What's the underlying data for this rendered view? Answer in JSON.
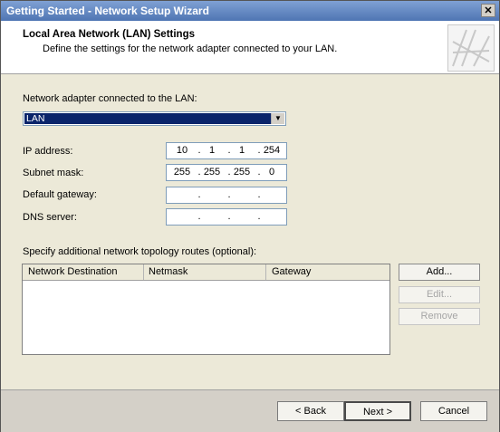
{
  "window": {
    "title": "Getting Started - Network Setup Wizard",
    "close_glyph": "✕"
  },
  "header": {
    "title": "Local Area Network (LAN) Settings",
    "subtitle": "Define the settings for the network adapter connected to your LAN."
  },
  "adapter": {
    "label": "Network adapter connected to the LAN:",
    "selected": "LAN"
  },
  "fields": {
    "ip": {
      "label": "IP address:",
      "octets": [
        "10",
        "1",
        "1",
        "254"
      ]
    },
    "subnet": {
      "label": "Subnet mask:",
      "octets": [
        "255",
        "255",
        "255",
        "0"
      ]
    },
    "gateway": {
      "label": "Default gateway:",
      "octets": [
        "",
        "",
        "",
        ""
      ]
    },
    "dns": {
      "label": "DNS server:",
      "octets": [
        "",
        "",
        "",
        ""
      ]
    }
  },
  "routes": {
    "label": "Specify additional network topology routes (optional):",
    "columns": [
      "Network Destination",
      "Netmask",
      "Gateway"
    ],
    "rows": []
  },
  "route_buttons": {
    "add": "Add...",
    "edit": "Edit...",
    "remove": "Remove"
  },
  "footer": {
    "back": "< Back",
    "next": "Next >",
    "cancel": "Cancel"
  }
}
